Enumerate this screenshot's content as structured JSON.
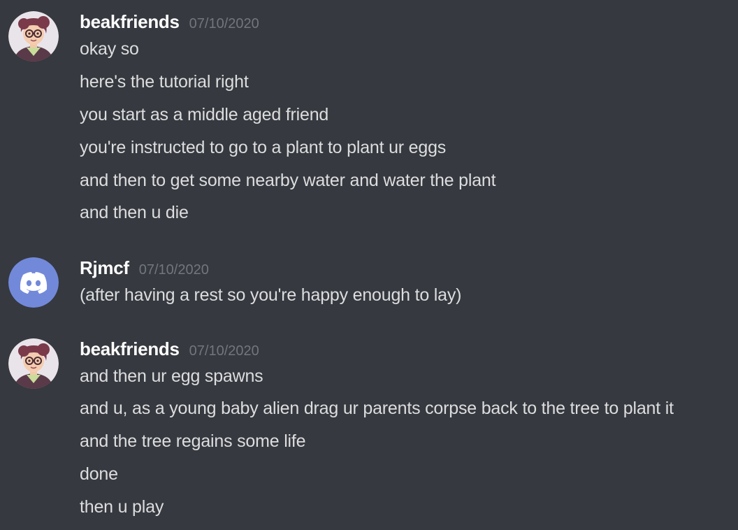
{
  "messages": [
    {
      "username": "beakfriends",
      "timestamp": "07/10/2020",
      "avatar": "cartoon-person-avatar",
      "lines": [
        "okay so",
        "here's the tutorial right",
        "you start as a middle aged friend",
        "you're instructed to go to a plant to plant ur eggs",
        "and then to get some nearby water and water the plant",
        "and then u die"
      ]
    },
    {
      "username": "Rjmcf",
      "timestamp": "07/10/2020",
      "avatar": "discord-logo-icon",
      "avatar_color": "#7289da",
      "lines": [
        "(after having a rest so you're happy enough to lay)"
      ]
    },
    {
      "username": "beakfriends",
      "timestamp": "07/10/2020",
      "avatar": "cartoon-person-avatar",
      "lines": [
        "and then ur egg spawns",
        "and u, as a young baby alien drag ur parents corpse back to the tree to plant it",
        "and the tree regains some life",
        "done",
        "then u play"
      ]
    }
  ],
  "colors": {
    "background": "#36393f",
    "username": "#ffffff",
    "message_text": "#dcddde",
    "timestamp": "#72767d",
    "discord_blurple": "#7289da"
  }
}
